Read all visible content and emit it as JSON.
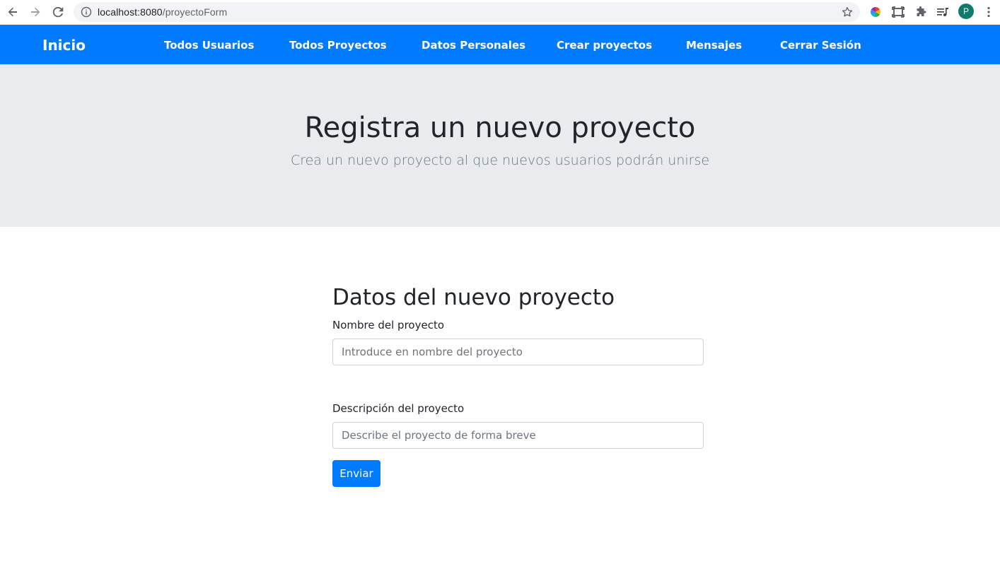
{
  "browser": {
    "url_host": "localhost:8080",
    "url_path": "/proyectoForm",
    "avatar_letter": "P",
    "icons": [
      "back-arrow-icon",
      "forward-arrow-icon",
      "reload-icon",
      "info-icon",
      "star-icon",
      "color-wheel-extension-icon",
      "screen-capture-icon",
      "puzzle-extensions-icon",
      "media-queue-icon",
      "kebab-menu-icon"
    ]
  },
  "navbar": {
    "brand": "Inicio",
    "links": [
      {
        "label": "Todos Usuarios"
      },
      {
        "label": "Todos Proyectos"
      },
      {
        "label": "Datos Personales"
      },
      {
        "label": "Crear proyectos"
      },
      {
        "label": "Mensajes"
      },
      {
        "label": "Cerrar Sesión"
      }
    ],
    "color": "#007bff"
  },
  "jumbotron": {
    "title": "Registra un nuevo proyecto",
    "lead": "Crea un nuevo proyecto al que nuevos usuarios podrán unirse",
    "background": "#e9ecef"
  },
  "form": {
    "title": "Datos del nuevo proyecto",
    "name_label": "Nombre del proyecto",
    "name_placeholder": "Introduce en nombre del proyecto",
    "name_value": "",
    "description_label": "Descripción del proyecto",
    "description_placeholder": "Describe el proyecto de forma breve",
    "description_value": "",
    "submit_label": "Enviar"
  }
}
